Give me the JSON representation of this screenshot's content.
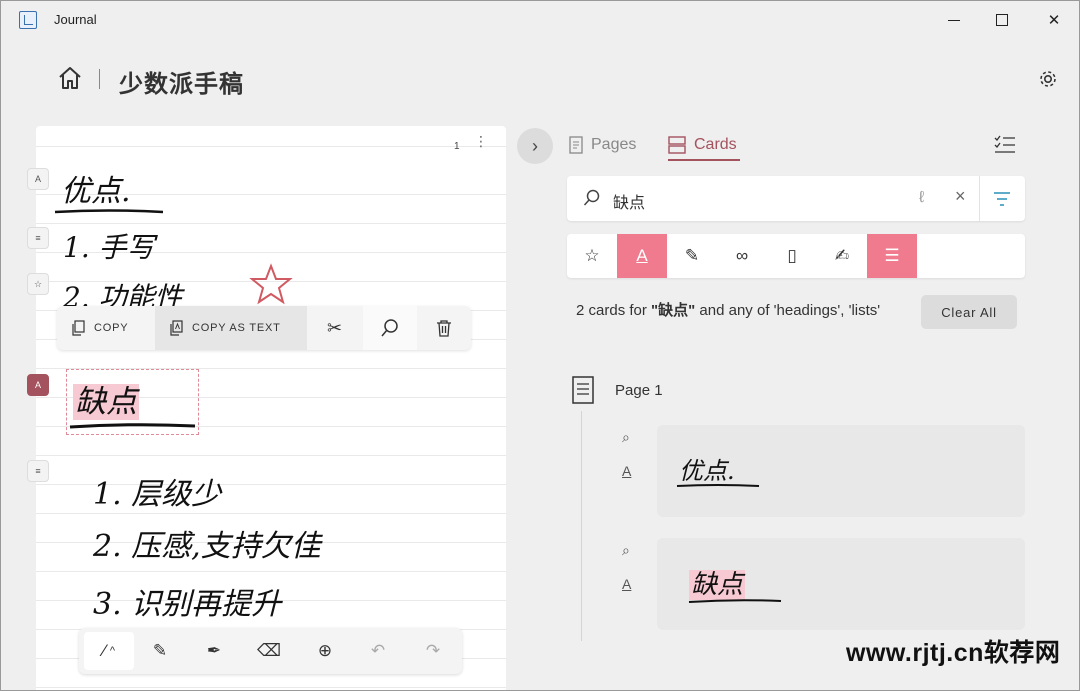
{
  "titlebar": {
    "app_title": "Journal"
  },
  "header": {
    "title": "少数派手稿"
  },
  "notebook": {
    "page_number": "1",
    "handwriting": {
      "heading1": "优点.",
      "item1": "1. 手写",
      "item2": "2. 功能性",
      "heading2": "缺点",
      "list2": [
        "1. 层级少",
        "2. 压感,支持欠佳",
        "3. 识别再提升"
      ]
    },
    "context_toolbar": {
      "copy_label": "COPY",
      "copy_as_text_label": "COPY AS TEXT"
    }
  },
  "panel": {
    "tabs": [
      {
        "label": "Pages"
      },
      {
        "label": "Cards"
      }
    ],
    "search": {
      "value": "缺点"
    },
    "result": {
      "prefix": "2 cards for ",
      "term": "\"缺点\"",
      "suffix": " and any of 'headings', 'lists'"
    },
    "clear_all_label": "Clear All",
    "page_group": {
      "label": "Page 1"
    },
    "cards": [
      {
        "text": "优点."
      },
      {
        "text": "缺点"
      }
    ]
  },
  "colors": {
    "accent": "#a4525e",
    "filter_active": "#f07a8e",
    "highlight": "#f6c9d3"
  },
  "watermark": {
    "text": "www.rjtj.cn软荐网"
  }
}
